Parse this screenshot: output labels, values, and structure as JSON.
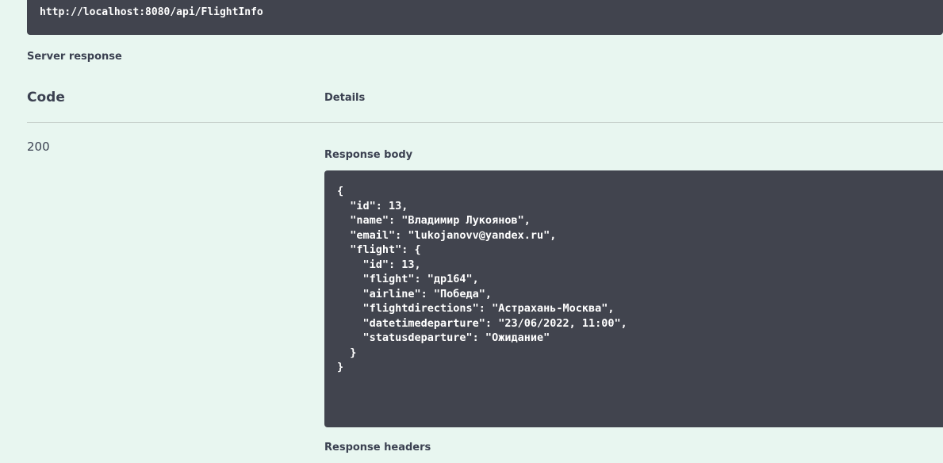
{
  "request": {
    "url": "http://localhost:8080/api/FlightInfo"
  },
  "server_response": {
    "heading": "Server response",
    "columns": {
      "code": "Code",
      "details": "Details"
    },
    "status_code": "200",
    "response_body_label": "Response body",
    "response_body": "{\n  \"id\": 13,\n  \"name\": \"Владимир Лукоянов\",\n  \"email\": \"lukojanovv@yandex.ru\",\n  \"flight\": {\n    \"id\": 13,\n    \"flight\": \"др164\",\n    \"airline\": \"Победа\",\n    \"flightdirections\": \"Астрахань-Москва\",\n    \"datetimedeparture\": \"23/06/2022, 11:00\",\n    \"statusdeparture\": \"Ожидание\"\n  }\n}",
    "response_headers_label": "Response headers"
  },
  "colors": {
    "background": "#e8f6f0",
    "code_block": "#41444e",
    "text": "#3b4151"
  }
}
